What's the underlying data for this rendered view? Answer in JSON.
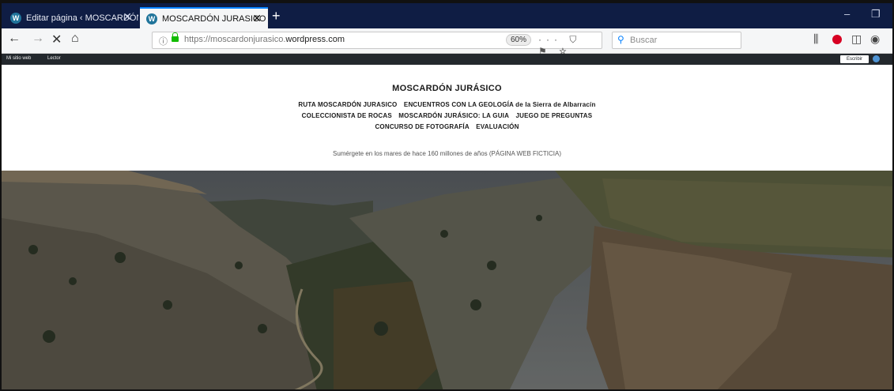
{
  "browser": {
    "tabs": [
      {
        "title": "Editar página ‹ MOSCARDÓN"
      },
      {
        "title": "MOSCARDÓN JURASICO"
      }
    ],
    "new_tab": "+",
    "window": {
      "minimize": "–",
      "restore": "❐"
    },
    "nav": {
      "back": "←",
      "forward": "→",
      "reload": "✕",
      "home": "⌂"
    },
    "address": {
      "protocol": "https://",
      "domain_prefix": "moscardonjurasico.",
      "domain": "wordpress.com",
      "zoom": "60%"
    },
    "page_actions": "··· ⛉ ⚑ ☆",
    "search": {
      "placeholder": "Buscar"
    }
  },
  "wp_admin_bar": {
    "my_site": "Mi sitio web",
    "reader": "Lector",
    "write": "Escribir"
  },
  "site": {
    "title": "MOSCARDÓN JURÁSICO",
    "menu_rows": [
      [
        "RUTA MOSCARDÓN JURASICO",
        "ENCUENTROS CON LA GEOLOGÍA de la Sierra de Albarracín"
      ],
      [
        "COLECCIONISTA DE ROCAS",
        "MOSCARDÓN JURÁSICO: LA GUIA",
        "JUEGO DE PREGUNTAS"
      ],
      [
        "CONCURSO DE FOTOGRAFÍA",
        "EVALUACIÓN"
      ]
    ],
    "tagline": "Sumérgete en los mares de hace 160 millones de años (PÁGINA WEB FICTICIA)"
  },
  "colors": {
    "tab_strip": "#0f1d44",
    "accent": "#0a84ff",
    "wp_bar": "#23282d",
    "wp_blue": "#21759b",
    "stop_red": "#d70022"
  }
}
